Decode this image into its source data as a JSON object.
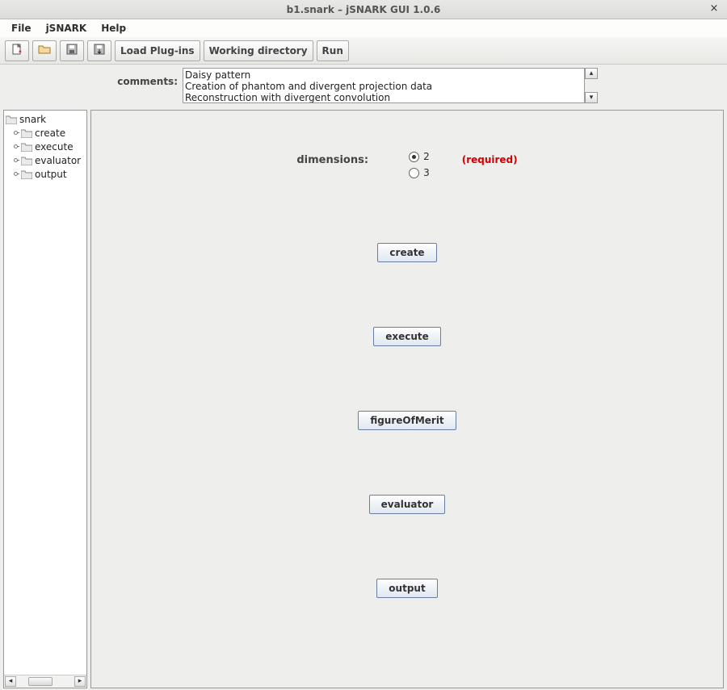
{
  "window": {
    "title": "b1.snark – jSNARK GUI 1.0.6",
    "close_glyph": "×"
  },
  "menubar": {
    "items": [
      "File",
      "jSNARK",
      "Help"
    ]
  },
  "toolbar": {
    "icon_buttons": [
      "new",
      "open",
      "save",
      "save-as"
    ],
    "text_buttons": [
      {
        "id": "load-plugins",
        "label": "Load Plug-ins"
      },
      {
        "id": "working-dir",
        "label": "Working directory"
      },
      {
        "id": "run",
        "label": "Run"
      }
    ]
  },
  "comments": {
    "label": "comments:",
    "lines": [
      "Daisy pattern",
      "Creation of phantom and divergent projection data",
      "Reconstruction with divergent convolution"
    ]
  },
  "tree": {
    "root": "snark",
    "children": [
      "create",
      "execute",
      "evaluator",
      "output"
    ]
  },
  "form": {
    "dimensions": {
      "label": "dimensions:",
      "options": [
        "2",
        "3"
      ],
      "selected": "2",
      "required_text": "(required)"
    },
    "actions": [
      {
        "id": "create",
        "label": "create"
      },
      {
        "id": "execute",
        "label": "execute"
      },
      {
        "id": "figureOfMerit",
        "label": "figureOfMerit"
      },
      {
        "id": "evaluator",
        "label": "evaluator"
      },
      {
        "id": "output",
        "label": "output"
      }
    ]
  }
}
